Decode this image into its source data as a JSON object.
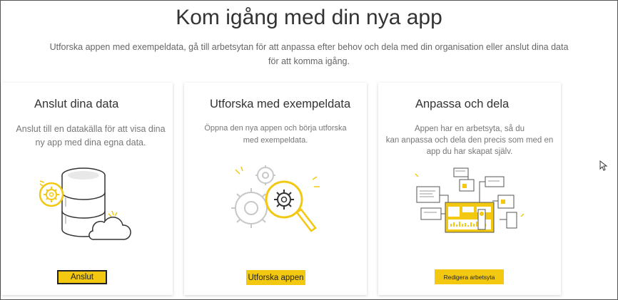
{
  "header": {
    "title": "Kom igång med din nya app",
    "subtitle_line1": "Utforska appen med exempeldata, gå till arbetsytan för att anpassa efter behov och dela med din organisation eller anslut dina data",
    "subtitle_line2": "för att komma igång."
  },
  "cards": [
    {
      "title": "Anslut dina data",
      "desc_line1": "Anslut till en datakälla för att visa dina",
      "desc_line2": "ny app med dina egna data.",
      "button": "Anslut",
      "icon": "database-cloud-illustration"
    },
    {
      "title": "Utforska med exempeldata",
      "desc_line1": "Öppna den nya appen och börja utforska",
      "desc_line2": "med exempeldata.",
      "button": "Utforska appen",
      "icon": "gears-magnifier-illustration"
    },
    {
      "title": "Anpassa och dela",
      "desc_line1": "Appen har en arbetsyta, så du",
      "desc_line2": "kan anpassa och dela den precis som med en",
      "desc_line3": "app du har skapat själv.",
      "button": "Redigera arbetsyta",
      "icon": "workspace-dashboard-illustration"
    }
  ],
  "colors": {
    "accent": "#f2c811",
    "text": "#333333",
    "muted": "#777777"
  }
}
